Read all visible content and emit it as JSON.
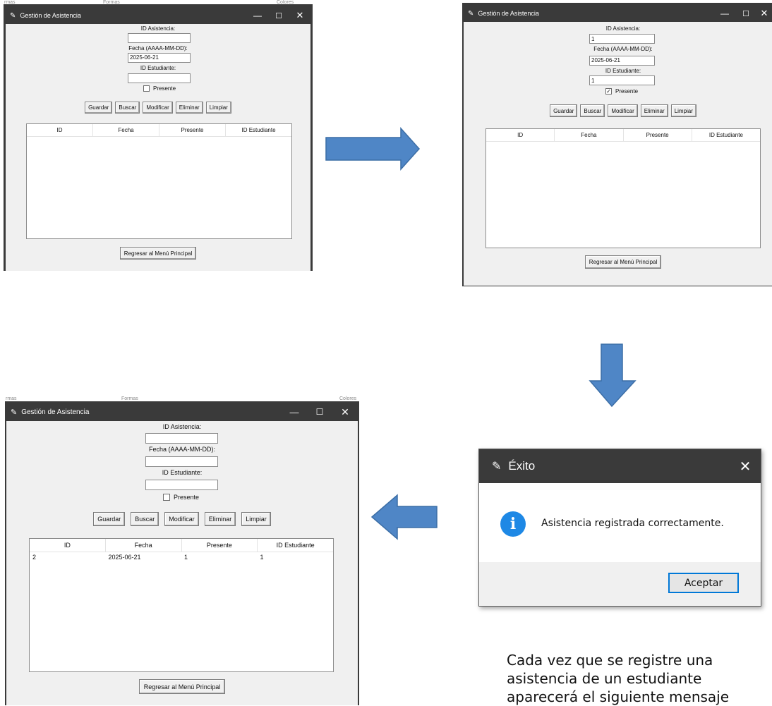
{
  "colors": {
    "titlebar": "#3a3a3a",
    "window_bg": "#f0f0f0",
    "arrow_fill": "#4f86c6",
    "arrow_stroke": "#3c6ea6",
    "info_icon": "#1e88e5",
    "dialog_ok_border": "#0078d7"
  },
  "windows": [
    {
      "title": "Gestión de Asistencia",
      "fields": {
        "id_label": "ID Asistencia:",
        "id_value": "",
        "fecha_label": "Fecha (AAAA-MM-DD):",
        "fecha_value": "2025-06-21",
        "est_label": "ID Estudiante:",
        "est_value": ""
      },
      "presente_label": "Presente",
      "presente_checked": false,
      "buttons": [
        "Guardar",
        "Buscar",
        "Modificar",
        "Eliminar",
        "Limpiar"
      ],
      "columns": [
        "ID",
        "Fecha",
        "Presente",
        "ID Estudiante"
      ],
      "rows": [],
      "back_label": "Regresar al Menú Principal"
    },
    {
      "title": "Gestión de Asistencia",
      "fields": {
        "id_label": "ID Asistencia:",
        "id_value": "1",
        "fecha_label": "Fecha (AAAA-MM-DD):",
        "fecha_value": "2025-06-21",
        "est_label": "ID Estudiante:",
        "est_value": "1"
      },
      "presente_label": "Presente",
      "presente_checked": true,
      "buttons": [
        "Guardar",
        "Buscar",
        "Modificar",
        "Eliminar",
        "Limpiar"
      ],
      "columns": [
        "ID",
        "Fecha",
        "Presente",
        "ID Estudiante"
      ],
      "rows": [],
      "back_label": "Regresar al Menú Principal"
    },
    {
      "title": "Gestión de Asistencia",
      "fields": {
        "id_label": "ID Asistencia:",
        "id_value": "",
        "fecha_label": "Fecha (AAAA-MM-DD):",
        "fecha_value": "",
        "est_label": "ID Estudiante:",
        "est_value": ""
      },
      "presente_label": "Presente",
      "presente_checked": false,
      "buttons": [
        "Guardar",
        "Buscar",
        "Modificar",
        "Eliminar",
        "Limpiar"
      ],
      "columns": [
        "ID",
        "Fecha",
        "Presente",
        "ID Estudiante"
      ],
      "rows": [
        [
          "2",
          "2025-06-21",
          "1",
          "1"
        ]
      ],
      "back_label": "Regresar al Menú Principal"
    }
  ],
  "dialog": {
    "title": "Éxito",
    "message": "Asistencia registrada correctamente.",
    "ok_label": "Aceptar"
  },
  "behind_text": {
    "left": "rmas",
    "middle": "Formas",
    "right": "Colores"
  },
  "caption": [
    "Cada vez que se registre una",
    "asistencia de un estudiante",
    "aparecerá el siguiente mensaje"
  ]
}
